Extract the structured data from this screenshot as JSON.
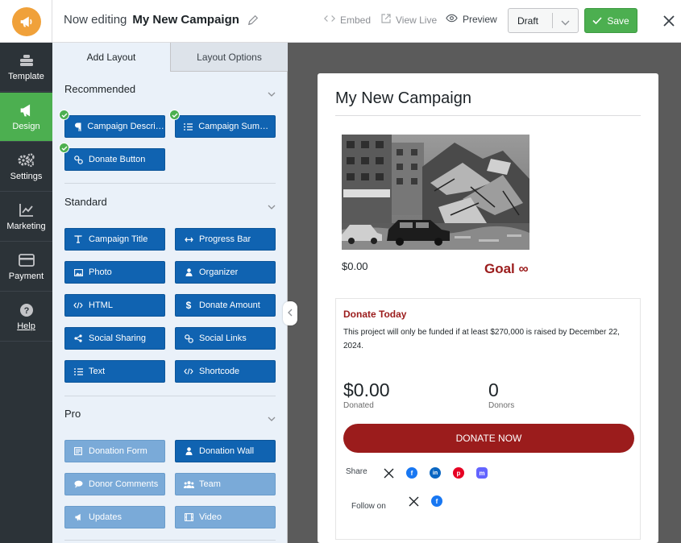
{
  "header": {
    "editing_label": "Now editing",
    "campaign_name": "My New Campaign",
    "embed_label": "Embed",
    "view_live_label": "View Live",
    "preview_label": "Preview",
    "status_value": "Draft",
    "save_label": "Save"
  },
  "sidebar": {
    "items": [
      {
        "label": "Template",
        "icon": "template-icon"
      },
      {
        "label": "Design",
        "icon": "megaphone-icon"
      },
      {
        "label": "Settings",
        "icon": "gears-icon"
      },
      {
        "label": "Marketing",
        "icon": "chart-icon"
      },
      {
        "label": "Payment",
        "icon": "card-icon"
      },
      {
        "label": "Help",
        "icon": "help-icon"
      }
    ]
  },
  "panel": {
    "tabs": [
      "Add Layout",
      "Layout Options"
    ],
    "sections": {
      "recommended": "Recommended",
      "standard": "Standard",
      "pro": "Pro"
    },
    "recommended_blocks": [
      {
        "label": "Campaign Description",
        "icon": "paragraph-icon"
      },
      {
        "label": "Campaign Summary",
        "icon": "list-icon"
      },
      {
        "label": "Donate Button",
        "icon": "link-icon"
      }
    ],
    "standard_blocks": [
      {
        "label": "Campaign Title",
        "icon": "title-icon"
      },
      {
        "label": "Progress Bar",
        "icon": "arrows-icon"
      },
      {
        "label": "Photo",
        "icon": "image-icon"
      },
      {
        "label": "Organizer",
        "icon": "user-icon"
      },
      {
        "label": "HTML",
        "icon": "code-icon"
      },
      {
        "label": "Donate Amount",
        "icon": "dollar-icon"
      },
      {
        "label": "Social Sharing",
        "icon": "share-icon"
      },
      {
        "label": "Social Links",
        "icon": "link-icon"
      },
      {
        "label": "Text",
        "icon": "list-icon"
      },
      {
        "label": "Shortcode",
        "icon": "code-icon"
      }
    ],
    "pro_blocks": [
      {
        "label": "Donation Form",
        "icon": "form-icon"
      },
      {
        "label": "Donation Wall",
        "icon": "user-icon"
      },
      {
        "label": "Donor Comments",
        "icon": "comment-icon"
      },
      {
        "label": "Team",
        "icon": "team-icon"
      },
      {
        "label": "Updates",
        "icon": "megaphone-icon"
      },
      {
        "label": "Video",
        "icon": "video-icon"
      }
    ]
  },
  "preview": {
    "title": "My New Campaign",
    "raised": "$0.00",
    "goal": "Goal ∞",
    "donate_title": "Donate Today",
    "donate_desc": "This project will only be funded if at least $270,000 is raised by December 22, 2024.",
    "donated_value": "$0.00",
    "donated_label": "Donated",
    "donors_value": "0",
    "donors_label": "Donors",
    "donate_button": "DONATE NOW",
    "share_label": "Share",
    "follow_label": "Follow on"
  },
  "colors": {
    "accent_green": "#4caf50",
    "block_blue": "#1063b1",
    "donate_red": "#9b1c1c",
    "sidebar_dark": "#2c3338"
  }
}
